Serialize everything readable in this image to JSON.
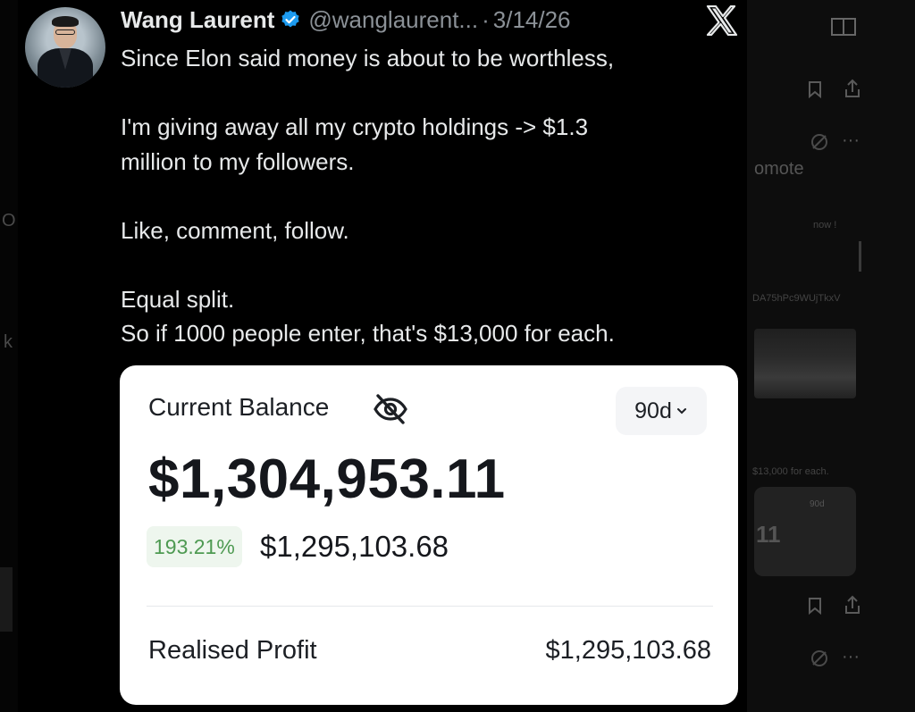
{
  "tweet": {
    "author_name": "Wang Laurent",
    "handle": "@wanglaurent...",
    "separator": "·",
    "date": "3/14/26",
    "lines": [
      "Since Elon said money is about to be worthless,",
      "",
      "I'm giving away all my crypto holdings -> $1.3",
      "million to my followers.",
      "",
      "Like, comment, follow.",
      "",
      "Equal split.",
      "So if 1000 people enter, that's $13,000 for each."
    ],
    "icons": [
      "verified-badge-icon",
      "x-logo-icon"
    ]
  },
  "balance_card": {
    "label": "Current Balance",
    "hide_icon": "eye-slash-icon",
    "period": "90d",
    "balance": "$1,304,953.11",
    "change_percent": "193.21%",
    "change_amount": "$1,295,103.68",
    "realised_profit_label": "Realised Profit",
    "realised_profit_value": "$1,295,103.68"
  },
  "background_app": {
    "promote_text": "omote",
    "link_text": "now !",
    "address_text": "DA75hPc9WUjTkxV",
    "repeat_text": "$13,000 for each.",
    "mini_period": "90d",
    "mini_balance": "11",
    "left_fragments": [
      "O",
      "k"
    ]
  },
  "colors": {
    "background": "#000000",
    "text": "#e7e9ea",
    "muted": "#8b9197",
    "verified": "#1d9bf0",
    "card": "#ffffff",
    "gain_green": "#4e9a52"
  }
}
